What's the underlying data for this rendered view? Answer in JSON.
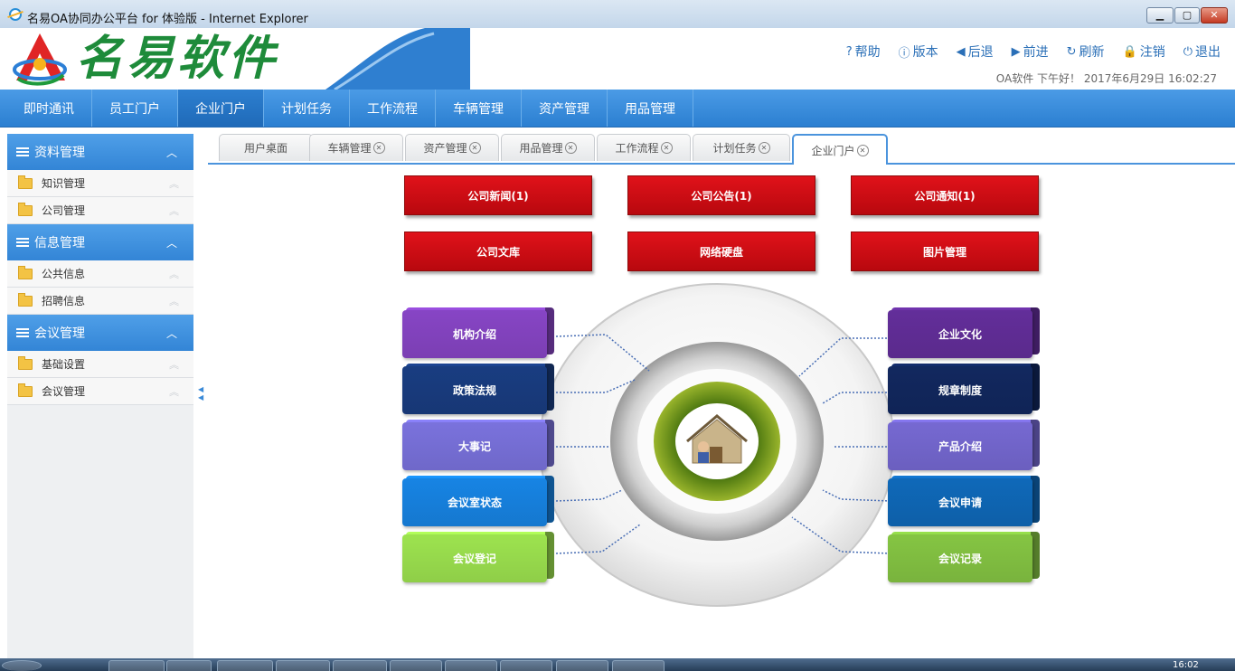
{
  "window": {
    "title": "名易OA协同办公平台 for 体验版 - Internet Explorer"
  },
  "header": {
    "logo_text": "名易软件",
    "toolbar": [
      {
        "icon": "help-icon",
        "glyph": "?",
        "label": "帮助"
      },
      {
        "icon": "info-icon",
        "glyph": "ⓘ",
        "label": "版本"
      },
      {
        "icon": "back-icon",
        "glyph": "◀",
        "label": "后退"
      },
      {
        "icon": "forward-icon",
        "glyph": "▶",
        "label": "前进"
      },
      {
        "icon": "refresh-icon",
        "glyph": "↻",
        "label": "刷新"
      },
      {
        "icon": "lock-icon",
        "glyph": "🔒",
        "label": "注销"
      },
      {
        "icon": "power-icon",
        "glyph": "⏻",
        "label": "退出"
      }
    ],
    "greeting": "OA软件 下午好！ 2017年6月29日 16:02:27"
  },
  "nav": {
    "items": [
      "即时通讯",
      "员工门户",
      "企业门户",
      "计划任务",
      "工作流程",
      "车辆管理",
      "资产管理",
      "用品管理"
    ],
    "active_index": 2
  },
  "sidebar": {
    "groups": [
      {
        "title": "资料管理",
        "items": [
          "知识管理",
          "公司管理"
        ]
      },
      {
        "title": "信息管理",
        "items": [
          "公共信息",
          "招聘信息"
        ]
      },
      {
        "title": "会议管理",
        "items": [
          "基础设置",
          "会议管理"
        ]
      }
    ]
  },
  "tabs": [
    {
      "label": "用户桌面",
      "closable": false
    },
    {
      "label": "车辆管理",
      "closable": true
    },
    {
      "label": "资产管理",
      "closable": true
    },
    {
      "label": "用品管理",
      "closable": true
    },
    {
      "label": "工作流程",
      "closable": true
    },
    {
      "label": "计划任务",
      "closable": true
    },
    {
      "label": "企业门户",
      "closable": true,
      "active": true
    }
  ],
  "portal": {
    "red_buttons": [
      "公司新闻(1)",
      "公司公告(1)",
      "公司通知(1)",
      "公司文库",
      "网络硬盘",
      "图片管理"
    ],
    "left_boxes": [
      "机构介绍",
      "政策法规",
      "大事记",
      "会议室状态",
      "会议登记"
    ],
    "right_boxes": [
      "企业文化",
      "规章制度",
      "产品介绍",
      "会议申请",
      "会议记录"
    ],
    "left_colors": [
      "#7b3fb3",
      "#173775",
      "#6f68c9",
      "#1578cf",
      "#8fce48"
    ],
    "right_colors": [
      "#5a2a8c",
      "#102456",
      "#6b5fbf",
      "#0e5fa8",
      "#79b33d"
    ],
    "accent": "#4b94dd",
    "red": "#d5101a"
  },
  "taskbar": {
    "time": "16:02"
  }
}
